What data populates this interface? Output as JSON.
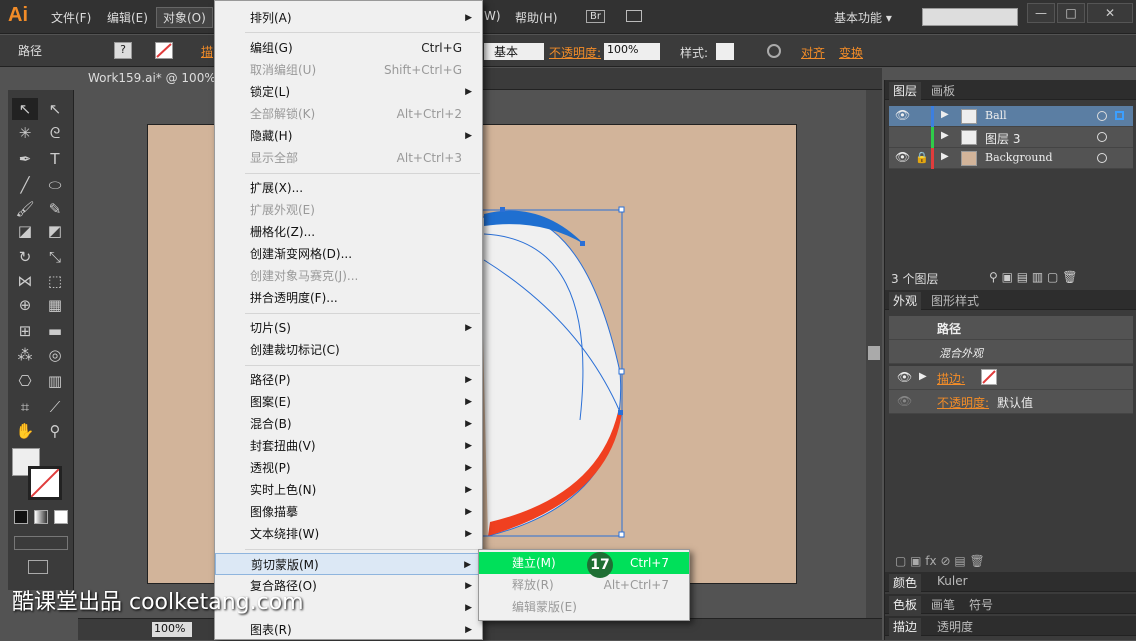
{
  "app": {
    "logo": "Ai",
    "workspace": "基本功能 ▾",
    "search_placeholder": ""
  },
  "menubar": {
    "items": [
      "文件(F)",
      "编辑(E)",
      "对象(O)"
    ],
    "right_items": [
      "W)",
      "帮助(H)",
      "Br"
    ]
  },
  "window": {
    "minimize": "—",
    "maximize": "□",
    "close": "✕"
  },
  "control": {
    "label": "路径",
    "stroke_label": "描",
    "basic": "基本",
    "opacity_label": "不透明度:",
    "opacity_value": "100%",
    "style_label": "样式:",
    "align": "对齐",
    "transform": "变换"
  },
  "document": {
    "tab": "Work159.ai* @ 100%",
    "zoom": "100%"
  },
  "menu": {
    "items": [
      {
        "label": "排列(A)",
        "shortcut": "",
        "arrow": true,
        "disabled": false
      },
      {
        "label": "编组(G)",
        "shortcut": "Ctrl+G",
        "arrow": false,
        "disabled": false
      },
      {
        "label": "取消编组(U)",
        "shortcut": "Shift+Ctrl+G",
        "arrow": false,
        "disabled": true
      },
      {
        "label": "锁定(L)",
        "shortcut": "",
        "arrow": true,
        "disabled": false
      },
      {
        "label": "全部解锁(K)",
        "shortcut": "Alt+Ctrl+2",
        "arrow": false,
        "disabled": true
      },
      {
        "label": "隐藏(H)",
        "shortcut": "",
        "arrow": true,
        "disabled": false
      },
      {
        "label": "显示全部",
        "shortcut": "Alt+Ctrl+3",
        "arrow": false,
        "disabled": true
      },
      {
        "label": "扩展(X)...",
        "shortcut": "",
        "arrow": false,
        "disabled": false
      },
      {
        "label": "扩展外观(E)",
        "shortcut": "",
        "arrow": false,
        "disabled": true
      },
      {
        "label": "栅格化(Z)...",
        "shortcut": "",
        "arrow": false,
        "disabled": false
      },
      {
        "label": "创建渐变网格(D)...",
        "shortcut": "",
        "arrow": false,
        "disabled": false
      },
      {
        "label": "创建对象马赛克(J)...",
        "shortcut": "",
        "arrow": false,
        "disabled": true
      },
      {
        "label": "拼合透明度(F)...",
        "shortcut": "",
        "arrow": false,
        "disabled": false
      },
      {
        "label": "切片(S)",
        "shortcut": "",
        "arrow": true,
        "disabled": false
      },
      {
        "label": "创建裁切标记(C)",
        "shortcut": "",
        "arrow": false,
        "disabled": false
      },
      {
        "label": "路径(P)",
        "shortcut": "",
        "arrow": true,
        "disabled": false
      },
      {
        "label": "图案(E)",
        "shortcut": "",
        "arrow": true,
        "disabled": false
      },
      {
        "label": "混合(B)",
        "shortcut": "",
        "arrow": true,
        "disabled": false
      },
      {
        "label": "封套扭曲(V)",
        "shortcut": "",
        "arrow": true,
        "disabled": false
      },
      {
        "label": "透视(P)",
        "shortcut": "",
        "arrow": true,
        "disabled": false
      },
      {
        "label": "实时上色(N)",
        "shortcut": "",
        "arrow": true,
        "disabled": false
      },
      {
        "label": "图像描摹",
        "shortcut": "",
        "arrow": true,
        "disabled": false
      },
      {
        "label": "文本绕排(W)",
        "shortcut": "",
        "arrow": true,
        "disabled": false
      },
      {
        "label": "剪切蒙版(M)",
        "shortcut": "",
        "arrow": true,
        "disabled": false
      },
      {
        "label": "复合路径(O)",
        "shortcut": "",
        "arrow": true,
        "disabled": false
      },
      {
        "label": "",
        "shortcut": "",
        "arrow": true,
        "disabled": false
      },
      {
        "label": "图表(R)",
        "shortcut": "",
        "arrow": true,
        "disabled": false
      }
    ]
  },
  "submenu": {
    "items": [
      {
        "label": "建立(M)",
        "shortcut": "Ctrl+7"
      },
      {
        "label": "释放(R)",
        "shortcut": "Alt+Ctrl+7"
      },
      {
        "label": "编辑蒙版(E)",
        "shortcut": ""
      }
    ],
    "step": "17"
  },
  "layers": {
    "tabs": [
      "图层",
      "画板"
    ],
    "rows": [
      {
        "name": "Ball",
        "color": "#3c7fe0"
      },
      {
        "name": "图层 3",
        "color": "#2fcc4a"
      },
      {
        "name": "Background",
        "color": "#e03c3c"
      }
    ],
    "count": "3 个图层"
  },
  "appearance": {
    "tabs": [
      "外观",
      "图形样式"
    ],
    "title": "路径",
    "mixed": "混合外观",
    "stroke_label": "描边:",
    "opacity_label": "不透明度:",
    "opacity_value": "默认值"
  },
  "bottom_panels": {
    "row1": [
      "颜色",
      "Kuler"
    ],
    "row2": [
      "色板",
      "画笔",
      "符号"
    ],
    "row3": [
      "描边",
      "透明度"
    ]
  },
  "watermark": "酷课堂出品 coolketang.com"
}
